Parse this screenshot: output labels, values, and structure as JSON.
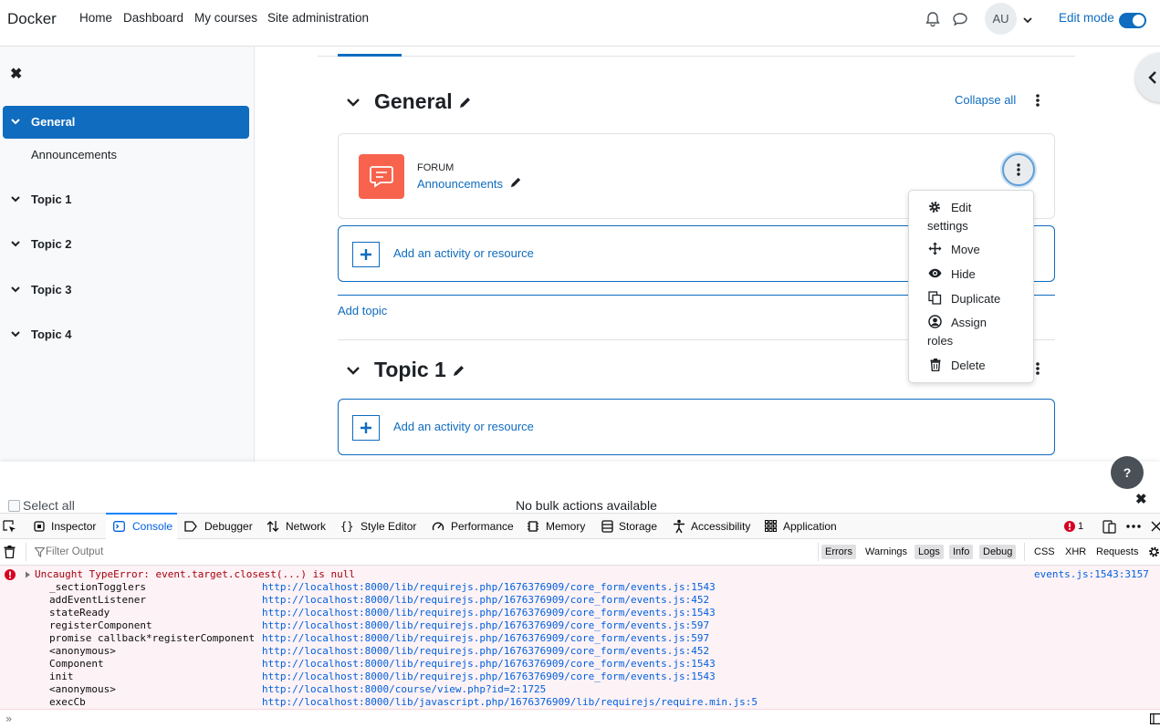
{
  "navbar": {
    "brand": "Docker",
    "links": [
      "Home",
      "Dashboard",
      "My courses",
      "Site administration"
    ],
    "avatar_initials": "AU",
    "edit_mode_label": "Edit mode",
    "edit_mode_on": true,
    "icons": [
      "bell-icon",
      "chat-icon",
      "chevron-down-icon"
    ]
  },
  "sidebar": {
    "close_icon": "close-icon",
    "items": [
      {
        "label": "General",
        "active": true
      },
      {
        "label": "Announcements"
      },
      {
        "label": "Topic 1"
      },
      {
        "label": "Topic 2"
      },
      {
        "label": "Topic 3"
      },
      {
        "label": "Topic 4"
      }
    ]
  },
  "course": {
    "sections": [
      {
        "title": "General"
      },
      {
        "title": "Topic 1"
      }
    ],
    "collapse_all": "Collapse all",
    "activity": {
      "type": "FORUM",
      "name": "Announcements"
    },
    "add_activity": "Add an activity or resource",
    "add_topic": "Add topic"
  },
  "action_menu": {
    "items": [
      {
        "icon": "gear-icon",
        "line1": "Edit",
        "line2": "settings"
      },
      {
        "icon": "move-icon",
        "line1": "Move"
      },
      {
        "icon": "eye-icon",
        "line1": "Hide"
      },
      {
        "icon": "duplicate-icon",
        "line1": "Duplicate"
      },
      {
        "icon": "user-circle-icon",
        "line1": "Assign",
        "line2": "roles"
      },
      {
        "icon": "trash-icon",
        "line1": "Delete"
      }
    ]
  },
  "bulk": {
    "help": "?",
    "select_all": "Select all",
    "status": "No bulk actions available"
  },
  "devtools": {
    "tabs": [
      "Inspector",
      "Console",
      "Debugger",
      "Network",
      "Style Editor",
      "Performance",
      "Memory",
      "Storage",
      "Accessibility",
      "Application"
    ],
    "active_tab": "Console",
    "error_count": "1",
    "filter_placeholder": "Filter Output",
    "filters": [
      {
        "label": "Errors",
        "on": true
      },
      {
        "label": "Warnings",
        "on": false
      },
      {
        "label": "Logs",
        "on": true
      },
      {
        "label": "Info",
        "on": true
      },
      {
        "label": "Debug",
        "on": true
      },
      {
        "label": "CSS",
        "on": false
      },
      {
        "label": "XHR",
        "on": false
      },
      {
        "label": "Requests",
        "on": false
      }
    ],
    "error": {
      "message": "Uncaught TypeError: event.target.closest(...) is null",
      "location": "events.js:1543:3157",
      "frames": [
        {
          "fn": "_sectionTogglers",
          "url": "http://localhost:8000/lib/requirejs.php/1676376909/core_form/events.js:1543"
        },
        {
          "fn": "addEventListener",
          "url": "http://localhost:8000/lib/requirejs.php/1676376909/core_form/events.js:452"
        },
        {
          "fn": "stateReady",
          "url": "http://localhost:8000/lib/requirejs.php/1676376909/core_form/events.js:1543"
        },
        {
          "fn": "registerComponent",
          "url": "http://localhost:8000/lib/requirejs.php/1676376909/core_form/events.js:597"
        },
        {
          "fn": "promise callback*registerComponent",
          "url": "http://localhost:8000/lib/requirejs.php/1676376909/core_form/events.js:597"
        },
        {
          "fn": "<anonymous>",
          "url": "http://localhost:8000/lib/requirejs.php/1676376909/core_form/events.js:452"
        },
        {
          "fn": "Component",
          "url": "http://localhost:8000/lib/requirejs.php/1676376909/core_form/events.js:1543"
        },
        {
          "fn": "init",
          "url": "http://localhost:8000/lib/requirejs.php/1676376909/core_form/events.js:1543"
        },
        {
          "fn": "<anonymous>",
          "url": "http://localhost:8000/course/view.php?id=2:1725"
        },
        {
          "fn": "execCb",
          "url": "http://localhost:8000/lib/javascript.php/1676376909/lib/requirejs/require.min.js:5"
        }
      ]
    },
    "prompt": "»"
  },
  "colors": {
    "accent": "#0f6cbf",
    "forum_icon": "#f7634d",
    "error_text": "#a4000f",
    "error_bg": "#fdf2f5",
    "devtools_link": "#0060df"
  }
}
